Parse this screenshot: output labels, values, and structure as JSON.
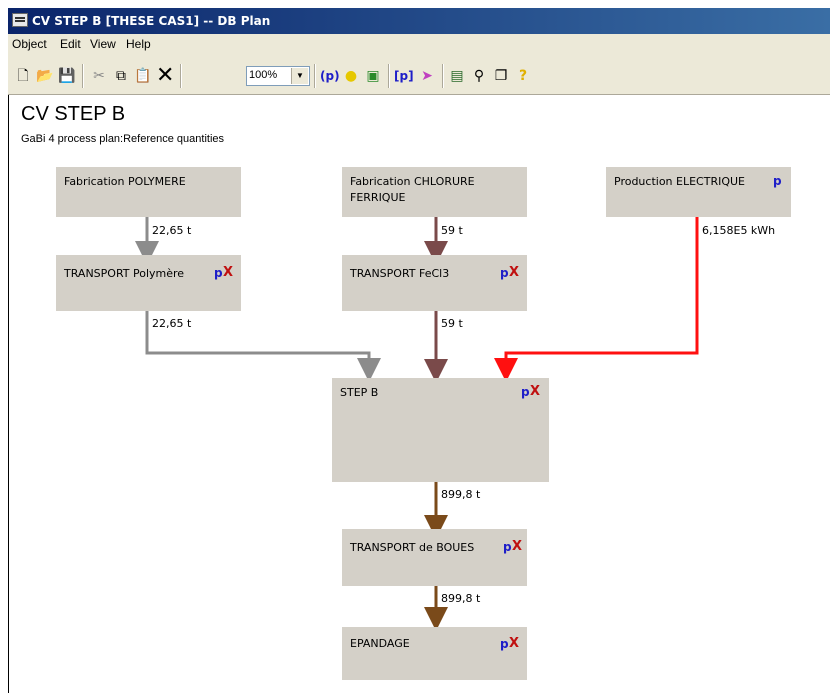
{
  "window": {
    "title": "CV STEP B [THESE CAS1] -- DB Plan"
  },
  "menu": {
    "items": [
      "Object",
      "Edit",
      "View",
      "Help"
    ]
  },
  "toolbar": {
    "zoom_value": "100%"
  },
  "plan": {
    "title": "CV STEP B",
    "subtitle": "GaBi 4 process plan:Reference quantities",
    "processes": {
      "polymere": "Fabrication POLYMERE",
      "chlorure_l1": "Fabrication CHLORURE",
      "chlorure_l2": "FERRIQUE",
      "electrique": "Production ELECTRIQUE",
      "transport_polymere": "TRANSPORT Polymère",
      "transport_fecl3": "TRANSPORT FeCl3",
      "step_b": "STEP B",
      "transport_boues": "TRANSPORT de BOUES",
      "epandage": "EPANDAGE"
    },
    "flows": {
      "poly_1": "22,65 t",
      "fecl3_1": "59 t",
      "elec": "6,158E5 kWh",
      "poly_2": "22,65 t",
      "fecl3_2": "59 t",
      "boues_1": "899,8 t",
      "boues_2": "899,8 t"
    },
    "p_label": "p",
    "x_label": "X",
    "colors": {
      "grey_flow": "#8c8c8c",
      "fecl3_flow": "#7a4a4a",
      "elec_flow": "#ff1010",
      "boues_flow": "#7a4a1a",
      "box": "#d4d0c8"
    }
  }
}
